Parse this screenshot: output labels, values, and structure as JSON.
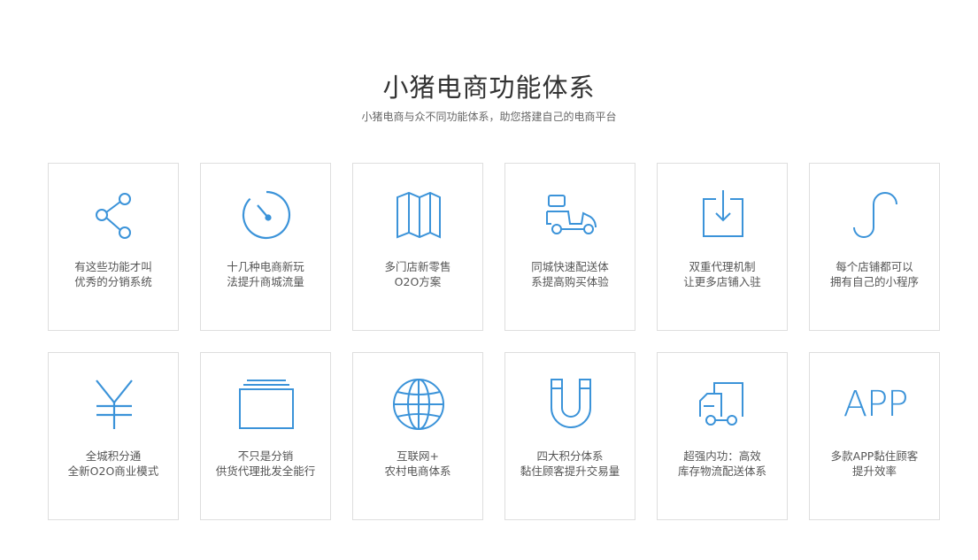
{
  "header": {
    "title": "小猪电商功能体系",
    "subtitle": "小猪电商与众不同功能体系，助您搭建自己的电商平台"
  },
  "accent_color": "#3b93d9",
  "features": [
    {
      "icon": "share-icon",
      "line1": "有这些功能才叫",
      "line2": "优秀的分销系统"
    },
    {
      "icon": "timer-icon",
      "line1": "十几种电商新玩",
      "line2": "法提升商城流量"
    },
    {
      "icon": "map-icon",
      "line1": "多门店新零售",
      "line2": "O2O方案"
    },
    {
      "icon": "scooter-icon",
      "line1": "同城快速配送体",
      "line2": "系提高购买体验"
    },
    {
      "icon": "download-box-icon",
      "line1": "双重代理机制",
      "line2": "让更多店铺入驻"
    },
    {
      "icon": "s-curve-icon",
      "line1": "每个店铺都可以",
      "line2": "拥有自己的小程序"
    },
    {
      "icon": "yen-icon",
      "line1": "全城积分通",
      "line2": "全新O2O商业模式"
    },
    {
      "icon": "stacked-box-icon",
      "line1": "不只是分销",
      "line2": "供货代理批发全能行"
    },
    {
      "icon": "globe-icon",
      "line1": "互联网+",
      "line2": "农村电商体系"
    },
    {
      "icon": "magnet-icon",
      "line1": "四大积分体系",
      "line2": "黏住顾客提升交易量"
    },
    {
      "icon": "truck-icon",
      "line1": "超强内功：高效",
      "line2": "库存物流配送体系"
    },
    {
      "icon": "app-text-icon",
      "icon_text": "APP",
      "line1": "多款APP黏住顾客",
      "line2": "提升效率"
    }
  ]
}
